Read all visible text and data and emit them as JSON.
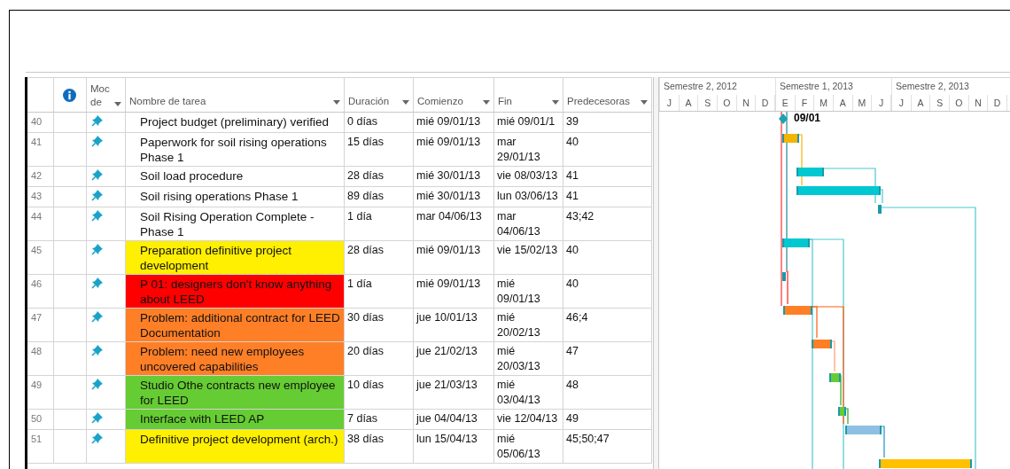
{
  "columns": [
    {
      "kind": "info"
    },
    {
      "kind": "text",
      "label": "Moc de"
    },
    {
      "kind": "text",
      "label": "Nombre de tarea"
    },
    {
      "kind": "text",
      "label": "Duración"
    },
    {
      "kind": "text",
      "label": "Comienzo"
    },
    {
      "kind": "text",
      "label": "Fin"
    },
    {
      "kind": "text",
      "label": "Predecesoras"
    }
  ],
  "timeline": [
    {
      "label": "Semestre 2, 2012",
      "months": [
        "J",
        "A",
        "S",
        "O",
        "N",
        "D"
      ]
    },
    {
      "label": "Semestre 1, 2013",
      "months": [
        "E",
        "F",
        "M",
        "A",
        "M",
        "J"
      ]
    },
    {
      "label": "Semestre 2, 2013",
      "months": [
        "J",
        "A",
        "S",
        "O",
        "N",
        "D"
      ]
    }
  ],
  "milestone_label": "09/01",
  "rows": [
    {
      "id": "40",
      "name": "Project budget (preliminary) verified",
      "duration": "0 días",
      "start": "mié 09/01/13",
      "finish": "mié 09/01/1",
      "predecessors": "39"
    },
    {
      "id": "41",
      "name": "Paperwork for soil rising operations Phase 1",
      "duration": "15 días",
      "start": "mié 09/01/13",
      "finish": "mar 29/01/13",
      "predecessors": "40"
    },
    {
      "id": "42",
      "name": "Soil load procedure",
      "duration": "28 días",
      "start": "mié 30/01/13",
      "finish": "vie 08/03/13",
      "predecessors": "41"
    },
    {
      "id": "43",
      "name": "Soil rising operations Phase 1",
      "duration": "89 días",
      "start": "mié 30/01/13",
      "finish": "lun 03/06/13",
      "predecessors": "41"
    },
    {
      "id": "44",
      "name": "Soil Rising Operation Complete - Phase 1",
      "duration": "1 día",
      "start": "mar 04/06/13",
      "finish": "mar 04/06/13",
      "predecessors": "43;42"
    },
    {
      "id": "45",
      "name": "Preparation definitive project development",
      "duration": "28 días",
      "start": "mié 09/01/13",
      "finish": "vie 15/02/13",
      "predecessors": "40",
      "color": "#ffef00"
    },
    {
      "id": "46",
      "name": "P 01: designers don't know anything about LEED",
      "duration": "1 día",
      "start": "mié 09/01/13",
      "finish": "mié 09/01/13",
      "predecessors": "40",
      "color": "#ff0000"
    },
    {
      "id": "47",
      "name": "Problem: additional contract for LEED Documentation",
      "duration": "30 días",
      "start": "jue 10/01/13",
      "finish": "mié 20/02/13",
      "predecessors": "46;4",
      "color": "#ff7f27"
    },
    {
      "id": "48",
      "name": "Problem: need new employees uncovered capabilities",
      "duration": "20 días",
      "start": "jue 21/02/13",
      "finish": "mié 20/03/13",
      "predecessors": "47",
      "color": "#ff7f27"
    },
    {
      "id": "49",
      "name": "Studio Othe contracts new employee for LEED",
      "duration": "10 días",
      "start": "jue 21/03/13",
      "finish": "mié 03/04/13",
      "predecessors": "48",
      "color": "#66cc33"
    },
    {
      "id": "50",
      "name": "Interface with LEED AP",
      "duration": "7 días",
      "start": "jue 04/04/13",
      "finish": "vie 12/04/13",
      "predecessors": "49",
      "color": "#66cc33"
    },
    {
      "id": "51",
      "name": "Definitive project development (arch.)",
      "duration": "38 días",
      "start": "lun 15/04/13",
      "finish": "mié 05/06/13",
      "predecessors": "45;50;47",
      "color": "#ffef00"
    }
  ]
}
